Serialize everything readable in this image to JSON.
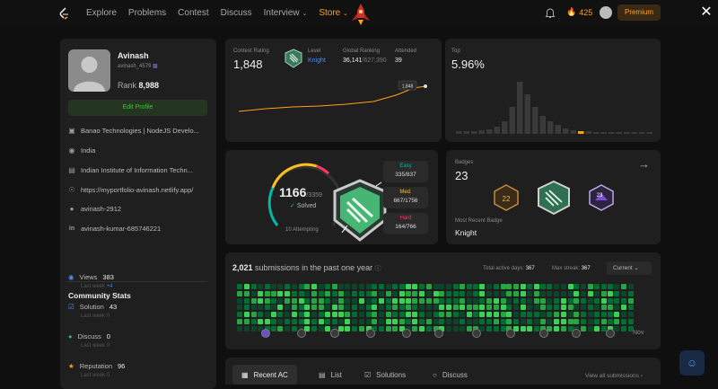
{
  "nav": {
    "links": [
      "Explore",
      "Problems",
      "Contest",
      "Discuss",
      "Interview",
      "Store"
    ],
    "fire_count": "425",
    "premium_label": "Premium"
  },
  "profile": {
    "name": "Avinash",
    "handle": "avinash_4579",
    "rank_label": "Rank",
    "rank_value": "8,988",
    "edit_label": "Edit Profile",
    "info": [
      {
        "icon": "building-icon",
        "text": "Banao Technologies | NodeJS Develo..."
      },
      {
        "icon": "location-icon",
        "text": "India"
      },
      {
        "icon": "school-icon",
        "text": "Indian Institute of Information Techn..."
      },
      {
        "icon": "globe-icon",
        "text": "https://myportfolio-avinash.netlify.app/"
      },
      {
        "icon": "github-icon",
        "text": "avinash-2912"
      },
      {
        "icon": "linkedin-icon",
        "text": "avinash-kumar-685746221"
      }
    ]
  },
  "community": {
    "title": "Community Stats",
    "stats": [
      {
        "icon": "eye-icon",
        "color": "#4a8ef5",
        "label": "Views",
        "value": "383",
        "lw": "Last week",
        "delta": "+4"
      },
      {
        "icon": "check-icon",
        "color": "#4a8ef5",
        "label": "Solution",
        "value": "43",
        "lw": "Last week",
        "delta": "0"
      },
      {
        "icon": "chat-icon",
        "color": "#28b496",
        "label": "Discuss",
        "value": "0",
        "lw": "Last week",
        "delta": "0"
      },
      {
        "icon": "star-icon",
        "color": "#ffa116",
        "label": "Reputation",
        "value": "96",
        "lw": "Last week",
        "delta": "0"
      }
    ]
  },
  "contest": {
    "rating_label": "Contest Rating",
    "rating": "1,848",
    "level_label": "Level",
    "level": "Knight",
    "global_label": "Global Ranking",
    "global_rank": "36,141",
    "global_total": "/627,390",
    "attended_label": "Attended",
    "attended": "39",
    "line_tag": "1,848",
    "top_label": "Top",
    "top_value": "5.96%"
  },
  "solved": {
    "count": "1166",
    "total": "/3359",
    "label": "Solved",
    "attempting": "10 Attempting",
    "easy_label": "Easy",
    "easy": "335/837",
    "med_label": "Med.",
    "med": "667/1756",
    "hard_label": "Hard",
    "hard": "164/766"
  },
  "badges": {
    "title": "Badges",
    "count": "23",
    "recent_label": "Most Recent Badge",
    "recent": "Knight"
  },
  "submissions": {
    "count": "2,021",
    "text": "submissions in the past one year",
    "active_label": "Total active days:",
    "active": "367",
    "streak_label": "Max streak:",
    "streak": "367",
    "current": "Current",
    "month": "Nov"
  },
  "tabs": {
    "items": [
      "Recent AC",
      "List",
      "Solutions",
      "Discuss"
    ],
    "view_all": "View all submissions"
  },
  "colors": {
    "accent": "#ffa116",
    "easy": "#00b8a3",
    "medium": "#ffc01e",
    "hard": "#ff375f",
    "green": "#2cbb5d"
  }
}
